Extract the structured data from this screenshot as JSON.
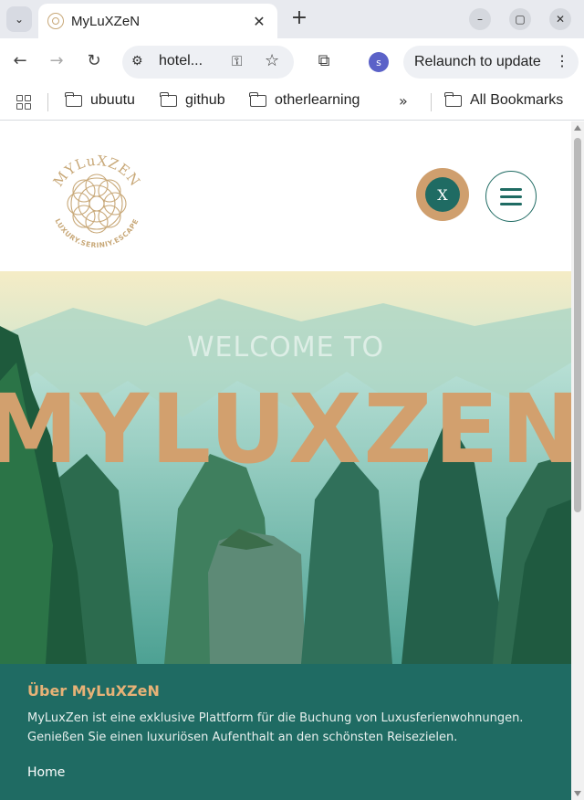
{
  "browser": {
    "tab_title": "MyLuXZeN",
    "url": "hotel...",
    "profile_initial": "s",
    "relaunch_label": "Relaunch to update",
    "bookmarks": [
      "ubuutu",
      "github",
      "otherlearning"
    ],
    "bookmarks_overflow": "»",
    "all_bookmarks": "All Bookmarks"
  },
  "site": {
    "logo_top_text": "MYLuXZEN",
    "logo_bottom_text": "LUXURY.SERINIY.ESCAPE",
    "close_label": "X",
    "hero": {
      "welcome": "WELCOME TO",
      "title": "MYLUXZEN"
    },
    "about": {
      "heading": "Über MyLuXZeN",
      "text": "MyLuxZen ist eine exklusive Plattform für die Buchung von Luxusferienwohnungen. Genießen Sie einen luxuriösen Aufenthalt an den schönsten Reisezielen.",
      "home_link": "Home"
    }
  },
  "colors": {
    "teal": "#1f6b63",
    "gold": "#d2a06e",
    "heading_gold": "#e7b277"
  }
}
